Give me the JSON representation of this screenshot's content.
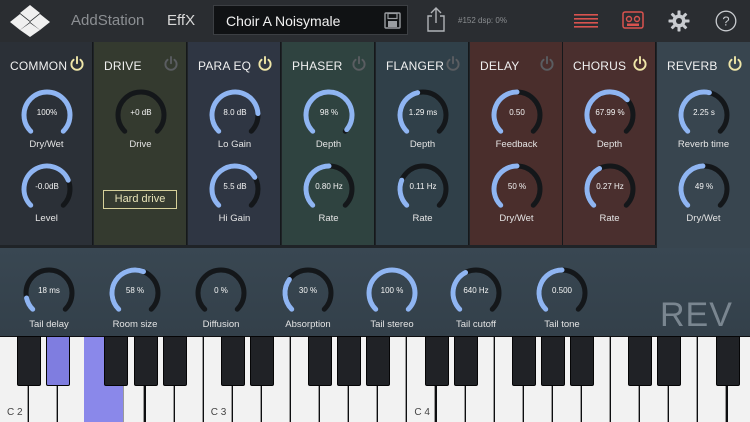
{
  "header": {
    "app_title": "AddStation",
    "effx_label": "EffX",
    "preset_name": "Choir A Noisymale",
    "status": "#152  dsp: 0%"
  },
  "colors": {
    "knob_arc": "#8fb5f2",
    "knob_track": "#14171a",
    "power_on": "#efe6a8",
    "power_off": "#5a5d61",
    "active_key": "#8a88ea"
  },
  "modules": [
    {
      "name": "COMMON",
      "power": "on",
      "bg": "#2b3037",
      "knobs": [
        {
          "value": "100%",
          "label": "Dry/Wet",
          "fraction": 1.0
        },
        {
          "value": "-0.0dB",
          "label": "Level",
          "fraction": 0.75
        }
      ]
    },
    {
      "name": "DRIVE",
      "power": "off",
      "bg": "#343a2f",
      "knobs": [
        {
          "value": "+0 dB",
          "label": "Drive",
          "fraction": 0.0
        }
      ],
      "button": "Hard drive"
    },
    {
      "name": "PARA EQ",
      "power": "on",
      "bg": "#2f3643",
      "knobs": [
        {
          "value": "8.0 dB",
          "label": "Lo Gain",
          "fraction": 0.82
        },
        {
          "value": "5.5 dB",
          "label": "Hi Gain",
          "fraction": 0.72
        }
      ]
    },
    {
      "name": "PHASER",
      "power": "off",
      "bg": "#2f4340",
      "knobs": [
        {
          "value": "98 %",
          "label": "Depth",
          "fraction": 0.98
        },
        {
          "value": "0.80 Hz",
          "label": "Rate",
          "fraction": 0.5
        }
      ]
    },
    {
      "name": "FLANGER",
      "power": "off",
      "bg": "#304049",
      "knobs": [
        {
          "value": "1.29  ms",
          "label": "Depth",
          "fraction": 0.45
        },
        {
          "value": "0.11  Hz",
          "label": "Rate",
          "fraction": 0.25
        }
      ]
    },
    {
      "name": "DELAY",
      "power": "off",
      "bg": "#4a2e2c",
      "knobs": [
        {
          "value": "0.50",
          "label": "Feedback",
          "fraction": 0.5
        },
        {
          "value": "50  %",
          "label": "Dry/Wet",
          "fraction": 0.5
        }
      ]
    },
    {
      "name": "CHORUS",
      "power": "on",
      "bg": "#4a2f2e",
      "knobs": [
        {
          "value": "67.99 %",
          "label": "Depth",
          "fraction": 0.68
        },
        {
          "value": "0.27  Hz",
          "label": "Rate",
          "fraction": 0.4
        }
      ]
    },
    {
      "name": "REVERB",
      "power": "on",
      "bg": "#38454f",
      "knobs": [
        {
          "value": "2.25 s",
          "label": "Reverb time",
          "fraction": 0.55
        },
        {
          "value": "49 %",
          "label": "Dry/Wet",
          "fraction": 0.49
        }
      ]
    }
  ],
  "reverb_page": {
    "title": "REV",
    "knobs": [
      {
        "value": "18 ms",
        "label": "Tail delay",
        "fraction": 0.12
      },
      {
        "value": "58 %",
        "label": "Room size",
        "fraction": 0.58
      },
      {
        "value": "0 %",
        "label": "Diffusion",
        "fraction": 0.0
      },
      {
        "value": "30 %",
        "label": "Absorption",
        "fraction": 0.3
      },
      {
        "value": "100 %",
        "label": "Tail stereo",
        "fraction": 1.0
      },
      {
        "value": "640 Hz",
        "label": "Tail cutoff",
        "fraction": 0.4
      },
      {
        "value": "0.500",
        "label": "Tail tone",
        "fraction": 0.5
      }
    ]
  },
  "keyboard": {
    "octave_labels": [
      "C 2",
      "C 3",
      "C 4"
    ],
    "active_key": "D#2"
  }
}
